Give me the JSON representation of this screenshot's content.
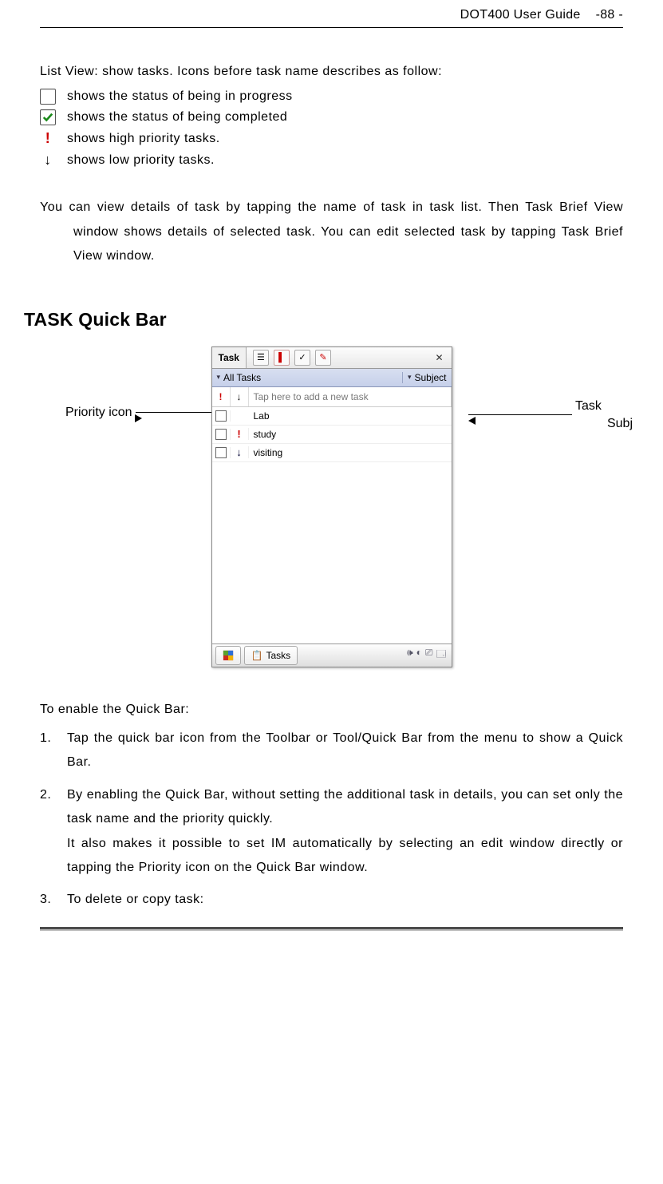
{
  "header": {
    "title_left": "DOT400 User Guide",
    "page_label": "-88 -"
  },
  "intro": {
    "list_view_line": "List View: show tasks. Icons before task name describes as follow:",
    "progress": "shows the status of being in progress",
    "completed": "shows the status of being completed",
    "high": "shows high priority tasks.",
    "low": "shows low priority tasks."
  },
  "details_paragraph": "You can view details of task by tapping the name of task in task list. Then Task Brief View window shows details of selected task. You can edit selected task by tapping Task Brief View window.",
  "section_heading": "TASK Quick Bar",
  "figure": {
    "pda": {
      "title_tab": "Task",
      "filter_left": "All Tasks",
      "filter_right": "Subject",
      "quick_add_placeholder": "Tap here to add a new task",
      "tasks": [
        {
          "name": "Lab",
          "priority": ""
        },
        {
          "name": "study",
          "priority": "high"
        },
        {
          "name": "visiting",
          "priority": "low"
        }
      ],
      "taskbar_button": "Tasks"
    },
    "callout_left": "Priority icon",
    "callout_right_a": "Task",
    "callout_right_b": "Subj"
  },
  "enable_heading": "To enable the Quick Bar:",
  "steps": {
    "s1_num": "1.",
    "s1": "Tap the quick bar icon from the Toolbar or Tool/Quick Bar from the menu to show a Quick Bar.",
    "s2_num": "2.",
    "s2a": "By enabling the Quick Bar, without setting the additional task in details, you can set only the task name and the priority quickly.",
    "s2b": "It also makes it possible to set IM automatically by selecting an edit window directly or tapping the Priority icon on the Quick Bar window.",
    "s3_num": "3.",
    "s3": "To delete or copy task:"
  }
}
